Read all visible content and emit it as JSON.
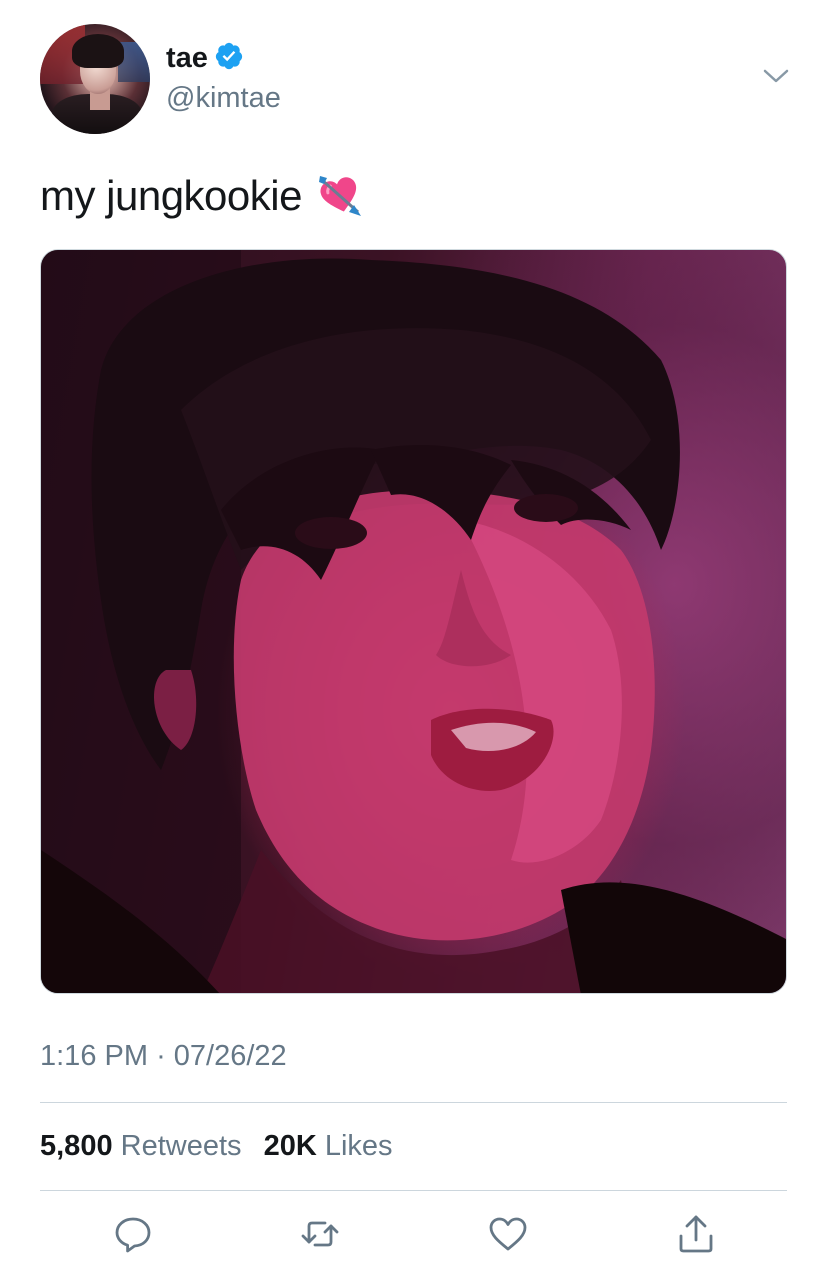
{
  "user": {
    "display_name": "tae",
    "handle": "@kimtae",
    "verified": true
  },
  "tweet": {
    "text": "my jungkookie",
    "emoji": "heart-with-arrow"
  },
  "meta": {
    "time": "1:16 PM",
    "separator": "·",
    "date": "07/26/22"
  },
  "stats": {
    "retweets_count": "5,800",
    "retweets_label": "Retweets",
    "likes_count": "20K",
    "likes_label": "Likes"
  },
  "actions": [
    {
      "name": "reply",
      "icon": "speech-bubble-icon"
    },
    {
      "name": "retweet",
      "icon": "retweet-arrows-icon"
    },
    {
      "name": "like",
      "icon": "heart-icon"
    },
    {
      "name": "share",
      "icon": "share-upload-icon"
    }
  ],
  "colors": {
    "text": "#14171a",
    "secondary": "#657786",
    "verified_blue": "#1da1f2",
    "divider": "#ccd6dd"
  }
}
